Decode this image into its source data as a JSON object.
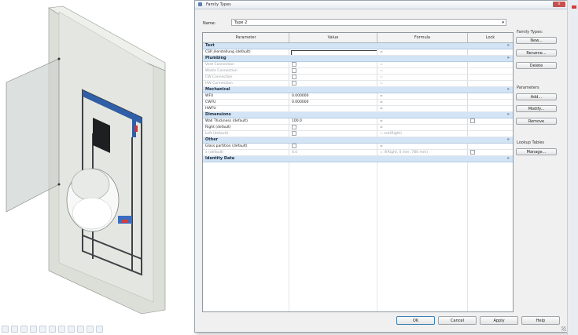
{
  "dialog": {
    "title": "Family Types",
    "close_label": "x",
    "name_label": "Name:",
    "name_value": "Type 2"
  },
  "table": {
    "headers": [
      "Parameter",
      "Value",
      "Formula",
      "Lock"
    ],
    "rows": [
      {
        "kind": "group",
        "label": "Text",
        "toggle": "»"
      },
      {
        "kind": "param",
        "param": "CSP_Herstellung (default)",
        "value": "",
        "formula": "=",
        "lock": "",
        "editing": true
      },
      {
        "kind": "group",
        "label": "Plumbing",
        "toggle": "»"
      },
      {
        "kind": "param",
        "param": "Vent Connection",
        "value": "",
        "formula": "=",
        "lock": "",
        "dim": true,
        "chk": true
      },
      {
        "kind": "param",
        "param": "Waste Connection",
        "value": "",
        "formula": "=",
        "lock": "",
        "dim": true,
        "chk": true
      },
      {
        "kind": "param",
        "param": "CW Connection",
        "value": "",
        "formula": "=",
        "lock": "",
        "dim": true,
        "chk": true
      },
      {
        "kind": "param",
        "param": "HW Connection",
        "value": "",
        "formula": "=",
        "lock": "",
        "dim": true,
        "chk": true
      },
      {
        "kind": "group",
        "label": "Mechanical",
        "toggle": "»"
      },
      {
        "kind": "param",
        "param": "WFU",
        "value": "0.000000",
        "formula": "=",
        "lock": ""
      },
      {
        "kind": "param",
        "param": "CWFU",
        "value": "0.000000",
        "formula": "=",
        "lock": ""
      },
      {
        "kind": "param",
        "param": "HWFU",
        "value": "",
        "formula": "=",
        "lock": ""
      },
      {
        "kind": "group",
        "label": "Dimensions",
        "toggle": "»"
      },
      {
        "kind": "param",
        "param": "Wall Thickness (default)",
        "value": "100.0",
        "formula": "=",
        "lock": "",
        "lockchk": true
      },
      {
        "kind": "param",
        "param": "Right (default)",
        "value": "",
        "formula": "=",
        "lock": "",
        "chk": true
      },
      {
        "kind": "param",
        "param": "Left (default)",
        "value": "",
        "formula": "= not(Right)",
        "lock": "",
        "dim": true,
        "chk": true
      },
      {
        "kind": "group",
        "label": "Other",
        "toggle": "»"
      },
      {
        "kind": "param",
        "param": "Glass partition (default)",
        "value": "",
        "formula": "=",
        "lock": "",
        "chk": true
      },
      {
        "kind": "param",
        "param": "x (default)",
        "value": "0.0",
        "formula": "= if(Right, 0 mm, 780 mm)",
        "lock": "",
        "dim": true,
        "lockchk": true
      },
      {
        "kind": "group",
        "label": "Identity Data",
        "toggle": "»"
      }
    ]
  },
  "side": {
    "family_types_label": "Family Types:",
    "new_label": "New...",
    "rename_label": "Rename...",
    "delete_label": "Delete",
    "parameters_label": "Parameters",
    "add_label": "Add...",
    "modify_label": "Modify...",
    "remove_label": "Remove",
    "lookup_label": "Lookup Tables",
    "manage_label": "Manage..."
  },
  "buttons": {
    "ok": "OK",
    "cancel": "Cancel",
    "apply": "Apply",
    "help": "Help"
  },
  "colors": {
    "group_header": "#d2e4f5",
    "frame_blue": "#2f5fa8",
    "wall": "#d9ddd6"
  },
  "icons": {
    "title": "family-types-icon",
    "close": "close-icon"
  }
}
